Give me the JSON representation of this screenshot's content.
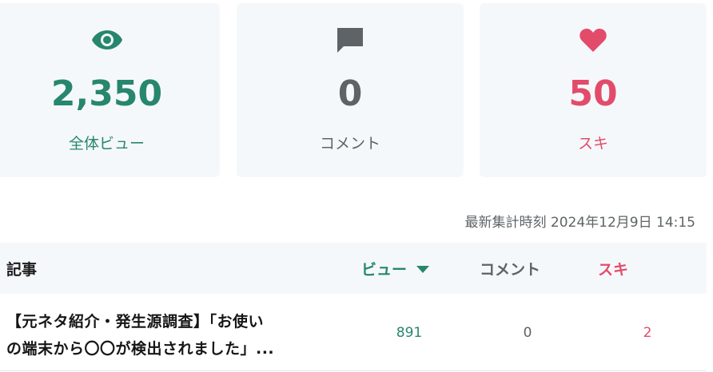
{
  "stats": {
    "views": {
      "icon": "eye-icon",
      "value": "2,350",
      "label": "全体ビュー",
      "color": "#27866e"
    },
    "comments": {
      "icon": "comment-icon",
      "value": "0",
      "label": "コメント",
      "color": "#5d6366"
    },
    "likes": {
      "icon": "heart-icon",
      "value": "50",
      "label": "スキ",
      "color": "#e34b6b"
    }
  },
  "timestamp": "最新集計時刻 2024年12月9日 14:15",
  "table": {
    "headers": {
      "article": "記事",
      "views": "ビュー",
      "comments": "コメント",
      "likes": "スキ"
    },
    "sort": {
      "column": "views",
      "direction": "descending"
    },
    "rows": [
      {
        "title_line1": "【元ネタ紹介・発生源調査】「お使い",
        "title_line2": "の端末から〇〇が検出されました」...",
        "views": "891",
        "comments": "0",
        "likes": "2"
      }
    ]
  }
}
